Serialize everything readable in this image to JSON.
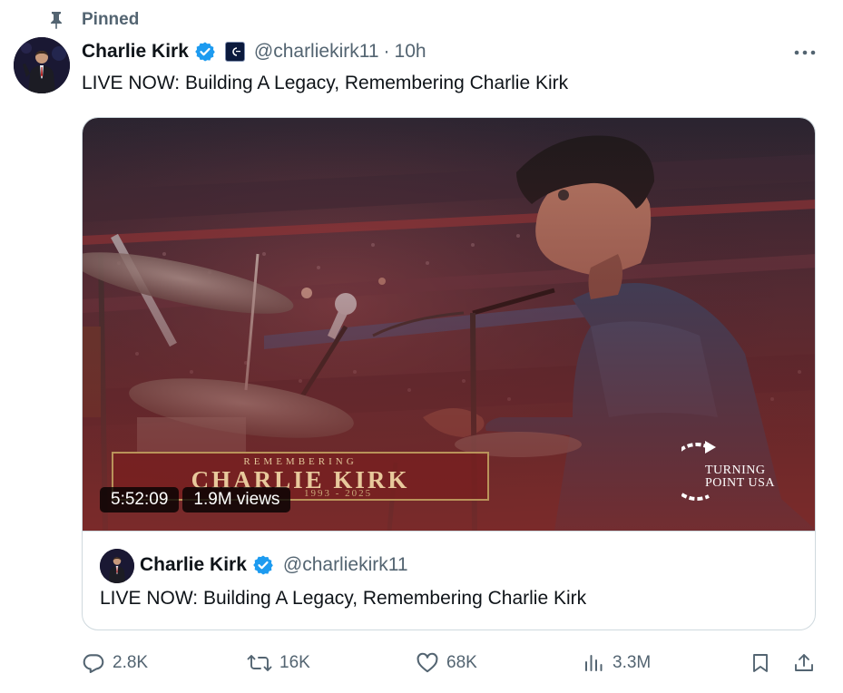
{
  "pinned": {
    "label": "Pinned"
  },
  "post": {
    "author_name": "Charlie Kirk",
    "handle": "@charliekirk11",
    "separator": "·",
    "timestamp": "10h",
    "text": "LIVE NOW: Building A Legacy, Remembering Charlie Kirk"
  },
  "video": {
    "banner_small": "REMEMBERING",
    "banner_title": "CHARLIE KIRK",
    "banner_years": "1993 - 2025",
    "duration": "5:52:09",
    "views": "1.9M views",
    "logo_line1": "TURNING",
    "logo_line2": "POINT USA"
  },
  "quote": {
    "author_name": "Charlie Kirk",
    "handle": "@charliekirk11",
    "text": "LIVE NOW: Building A Legacy, Remembering Charlie Kirk"
  },
  "actions": {
    "replies": "2.8K",
    "reposts": "16K",
    "likes": "68K",
    "views": "3.3M"
  },
  "icons": {
    "pin": "pin-icon",
    "verified": "verified-badge-icon",
    "affiliate": "affiliate-badge-icon",
    "more": "more-options-icon",
    "reply": "reply-icon",
    "repost": "repost-icon",
    "like": "heart-icon",
    "views": "analytics-icon",
    "bookmark": "bookmark-icon",
    "share": "share-icon"
  },
  "colors": {
    "verified_blue": "#1d9bf0",
    "secondary_text": "#536471",
    "primary_text": "#0f1419",
    "border": "#cfd9de"
  }
}
